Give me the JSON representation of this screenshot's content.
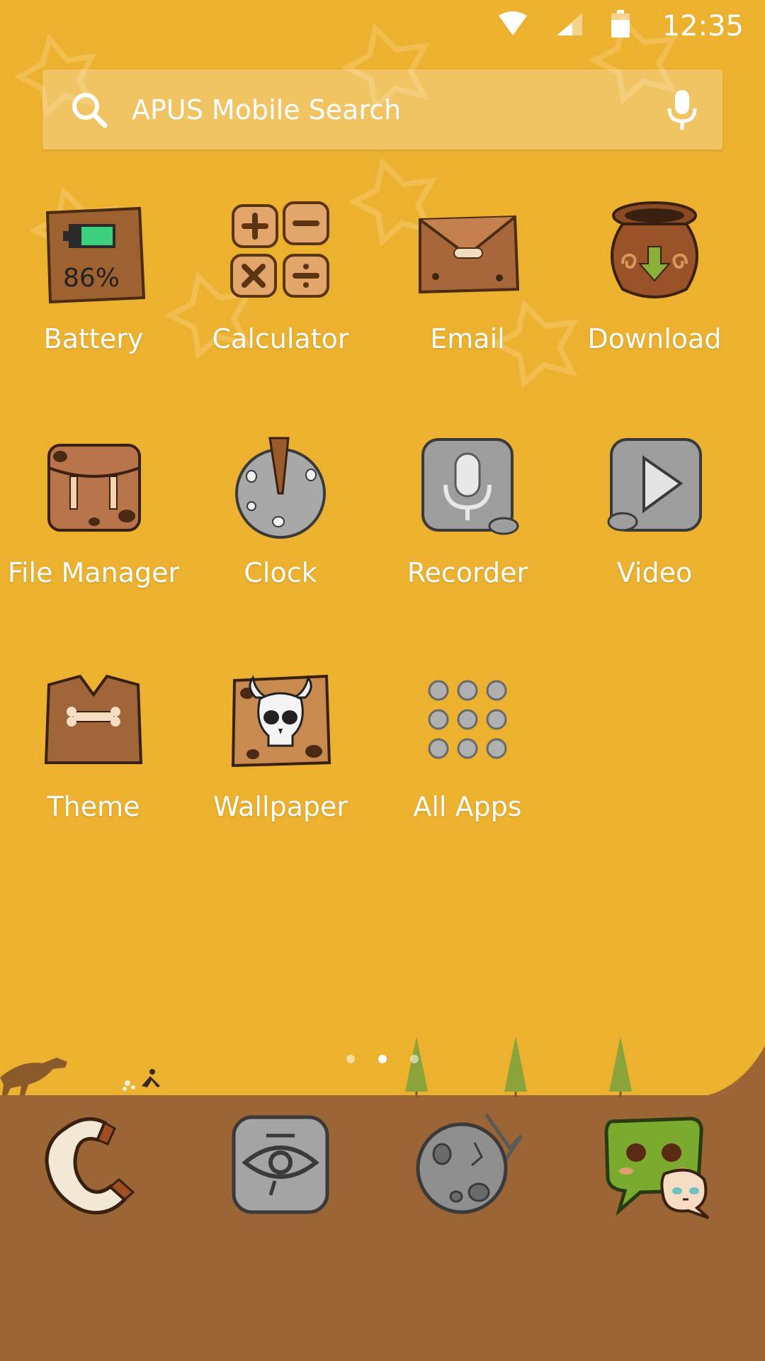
{
  "status_bar": {
    "time": "12:35"
  },
  "search": {
    "placeholder": "APUS Mobile Search"
  },
  "apps": [
    {
      "label": "Battery",
      "icon": "battery-icon",
      "battery_text": "86%"
    },
    {
      "label": "Calculator",
      "icon": "calculator-icon"
    },
    {
      "label": "Email",
      "icon": "email-icon"
    },
    {
      "label": "Download",
      "icon": "download-icon"
    },
    {
      "label": "File Manager",
      "icon": "file-manager-icon"
    },
    {
      "label": "Clock",
      "icon": "clock-icon"
    },
    {
      "label": "Recorder",
      "icon": "recorder-icon"
    },
    {
      "label": "Video",
      "icon": "video-icon"
    },
    {
      "label": "Theme",
      "icon": "theme-icon"
    },
    {
      "label": "Wallpaper",
      "icon": "wallpaper-icon"
    },
    {
      "label": "All Apps",
      "icon": "all-apps-icon"
    }
  ],
  "dock": [
    {
      "icon": "phone-icon"
    },
    {
      "icon": "eye-icon"
    },
    {
      "icon": "meteor-icon"
    },
    {
      "icon": "messages-icon"
    }
  ],
  "page_indicator": {
    "pages": 3,
    "active": 1
  },
  "colors": {
    "sky": "#ebb12f",
    "ground": "#9b6535",
    "tree": "#8aa33a"
  }
}
